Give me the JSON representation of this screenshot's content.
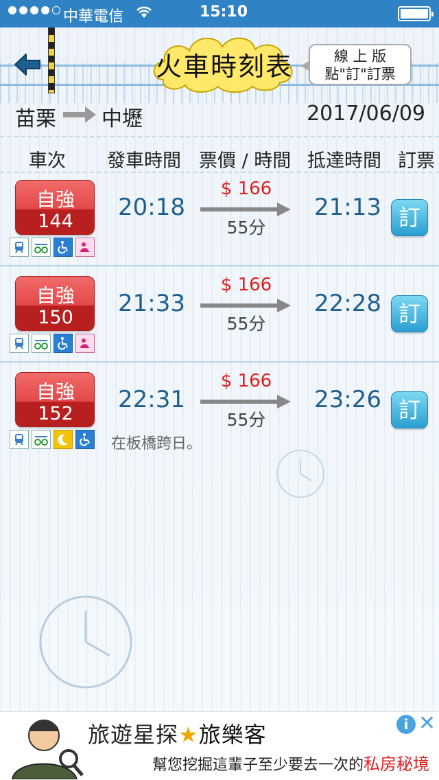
{
  "status_bar": {
    "carrier": "中華電信",
    "time": "15:10"
  },
  "header": {
    "title": "火車時刻表",
    "online_line1": "線 上 版",
    "online_line2": "點\"訂\"訂票"
  },
  "route": {
    "from": "苗栗",
    "to": "中壢",
    "date": "2017/06/09"
  },
  "columns": [
    "車次",
    "發車時間",
    "票價 / 時間",
    "抵達時間",
    "訂票"
  ],
  "trains": [
    {
      "type": "自強",
      "number": "144",
      "departure": "20:18",
      "price": "$ 166",
      "duration": "55分",
      "arrival": "21:13",
      "book_label": "訂",
      "note": ""
    },
    {
      "type": "自強",
      "number": "150",
      "departure": "21:33",
      "price": "$ 166",
      "duration": "55分",
      "arrival": "22:28",
      "book_label": "訂",
      "note": ""
    },
    {
      "type": "自強",
      "number": "152",
      "departure": "22:31",
      "price": "$ 166",
      "duration": "55分",
      "arrival": "23:26",
      "book_label": "訂",
      "note": "在板橋跨日。"
    }
  ],
  "ad": {
    "headline_a": "旅遊星探",
    "headline_b": "旅樂客",
    "tagline_a": "幫您挖掘這輩子至少要去一次的",
    "tagline_b": "私房秘境"
  },
  "colors": {
    "status_bar": "#2f83c4",
    "train_badge": "#d92a2a",
    "price": "#e02020",
    "time": "#1f5f8f",
    "book_button": "#2a9fd0"
  }
}
